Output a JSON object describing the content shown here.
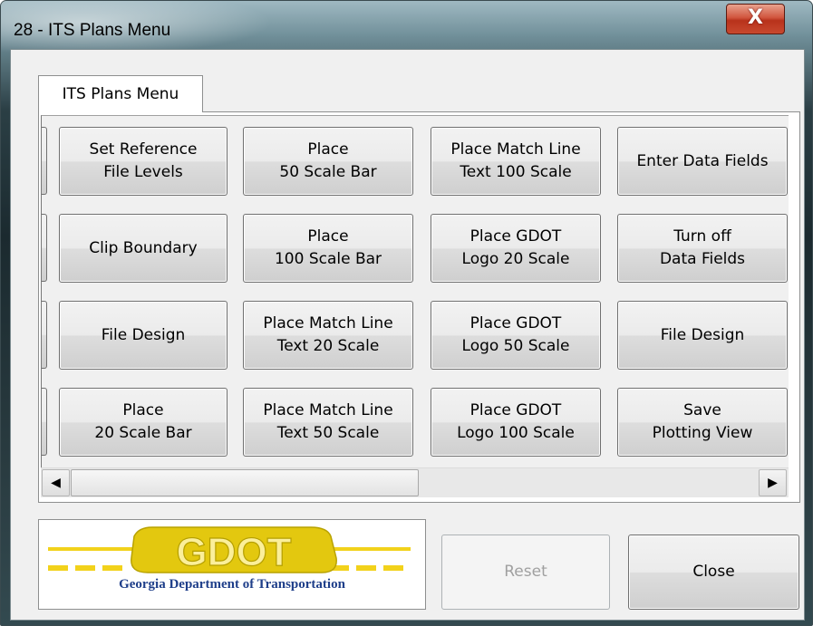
{
  "window": {
    "title": "28 - ITS Plans Menu",
    "close_glyph": "X"
  },
  "tab": {
    "label": "ITS Plans Menu"
  },
  "buttons": [
    [
      "Set Reference\nFile Levels",
      "Place\n50 Scale Bar",
      "Place Match Line\nText 100 Scale",
      "Enter Data Fields"
    ],
    [
      "Clip Boundary",
      "Place\n100 Scale Bar",
      "Place GDOT\nLogo 20 Scale",
      "Turn off\nData Fields"
    ],
    [
      "File Design",
      "Place Match Line\nText 20 Scale",
      "Place GDOT\nLogo 50 Scale",
      "File Design"
    ],
    [
      "Place\n20 Scale Bar",
      "Place Match Line\nText 50 Scale",
      "Place GDOT\nLogo 100 Scale",
      "Save\nPlotting View"
    ]
  ],
  "scrollbar": {
    "left_arrow": "◀",
    "right_arrow": "▶"
  },
  "logo": {
    "wordmark": "GDOT",
    "caption": "Georgia Department of Transportation",
    "colors": {
      "yellow": "#f2d21b",
      "navy": "#1f3f8a",
      "wordmark": "#c8b300"
    }
  },
  "footer": {
    "reset_label": "Reset",
    "close_label": "Close"
  }
}
